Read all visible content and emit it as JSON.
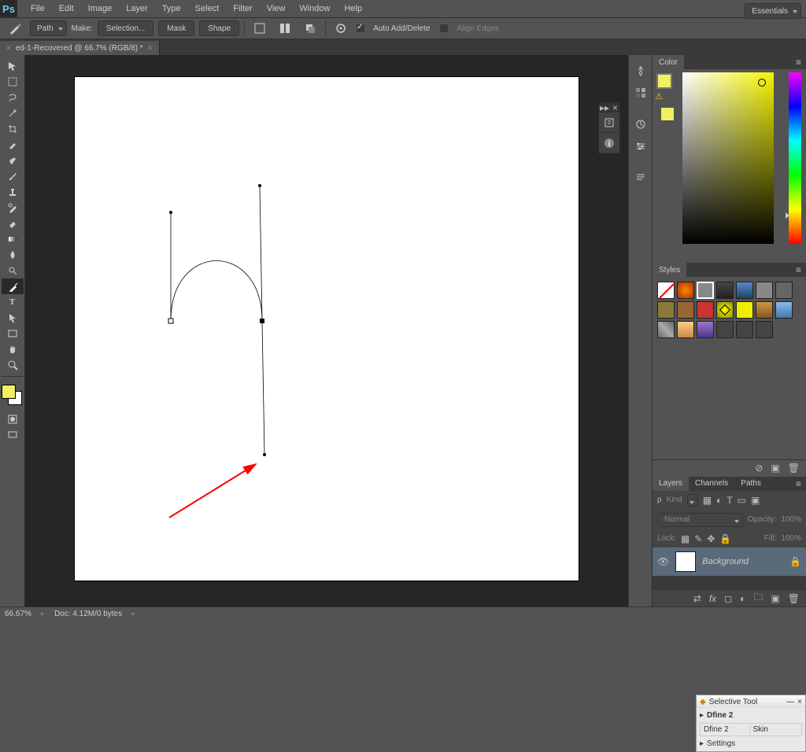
{
  "app": {
    "name": "Ps"
  },
  "menubar": [
    "File",
    "Edit",
    "Image",
    "Layer",
    "Type",
    "Select",
    "Filter",
    "View",
    "Window",
    "Help"
  ],
  "workspace": "Essentials",
  "options": {
    "pathmode": "Path",
    "make": "Make:",
    "selection": "Selection...",
    "mask": "Mask",
    "shape": "Shape",
    "auto": "Auto Add/Delete",
    "align": "Align Edges"
  },
  "doc": {
    "tab": "ed-1-Recovered @ 66.7% (RGB/8) *"
  },
  "panels": {
    "color": "Color",
    "styles": "Styles",
    "layers": "Layers",
    "channels": "Channels",
    "paths": "Paths"
  },
  "selective": {
    "title": "Selective Tool",
    "item": "Dfine 2",
    "sub1": "Dfine 2",
    "sub2": "Skin",
    "settings": "Settings"
  },
  "layers": {
    "kind": "Kind",
    "blend": "Normal",
    "opacity_lbl": "Opacity:",
    "opacity": "100%",
    "lock": "Lock:",
    "fill_lbl": "Fill:",
    "fill": "100%",
    "bg": "Background"
  },
  "status": {
    "zoom": "66.67%",
    "doc": "Doc: 4.12M/0 bytes"
  },
  "colors": {
    "fg": "#f0f060",
    "bg": "#ffffff"
  }
}
